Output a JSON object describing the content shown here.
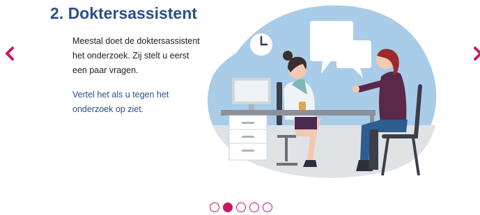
{
  "slide": {
    "title": "2. Doktersassistent",
    "paragraph1": "Meestal doet de doktersassistent het onderzoek. Zij stelt u eerst een paar vragen.",
    "paragraph2": "Vertel het als u tegen het onderzoek op ziet."
  },
  "nav": {
    "prev_icon": "chevron-left-icon",
    "next_icon": "chevron-right-icon"
  },
  "pagination": {
    "total": 5,
    "active_index": 1
  },
  "colors": {
    "accent": "#c8176b",
    "heading": "#2b4e8c",
    "illustration_bg": "#a9cce9"
  }
}
